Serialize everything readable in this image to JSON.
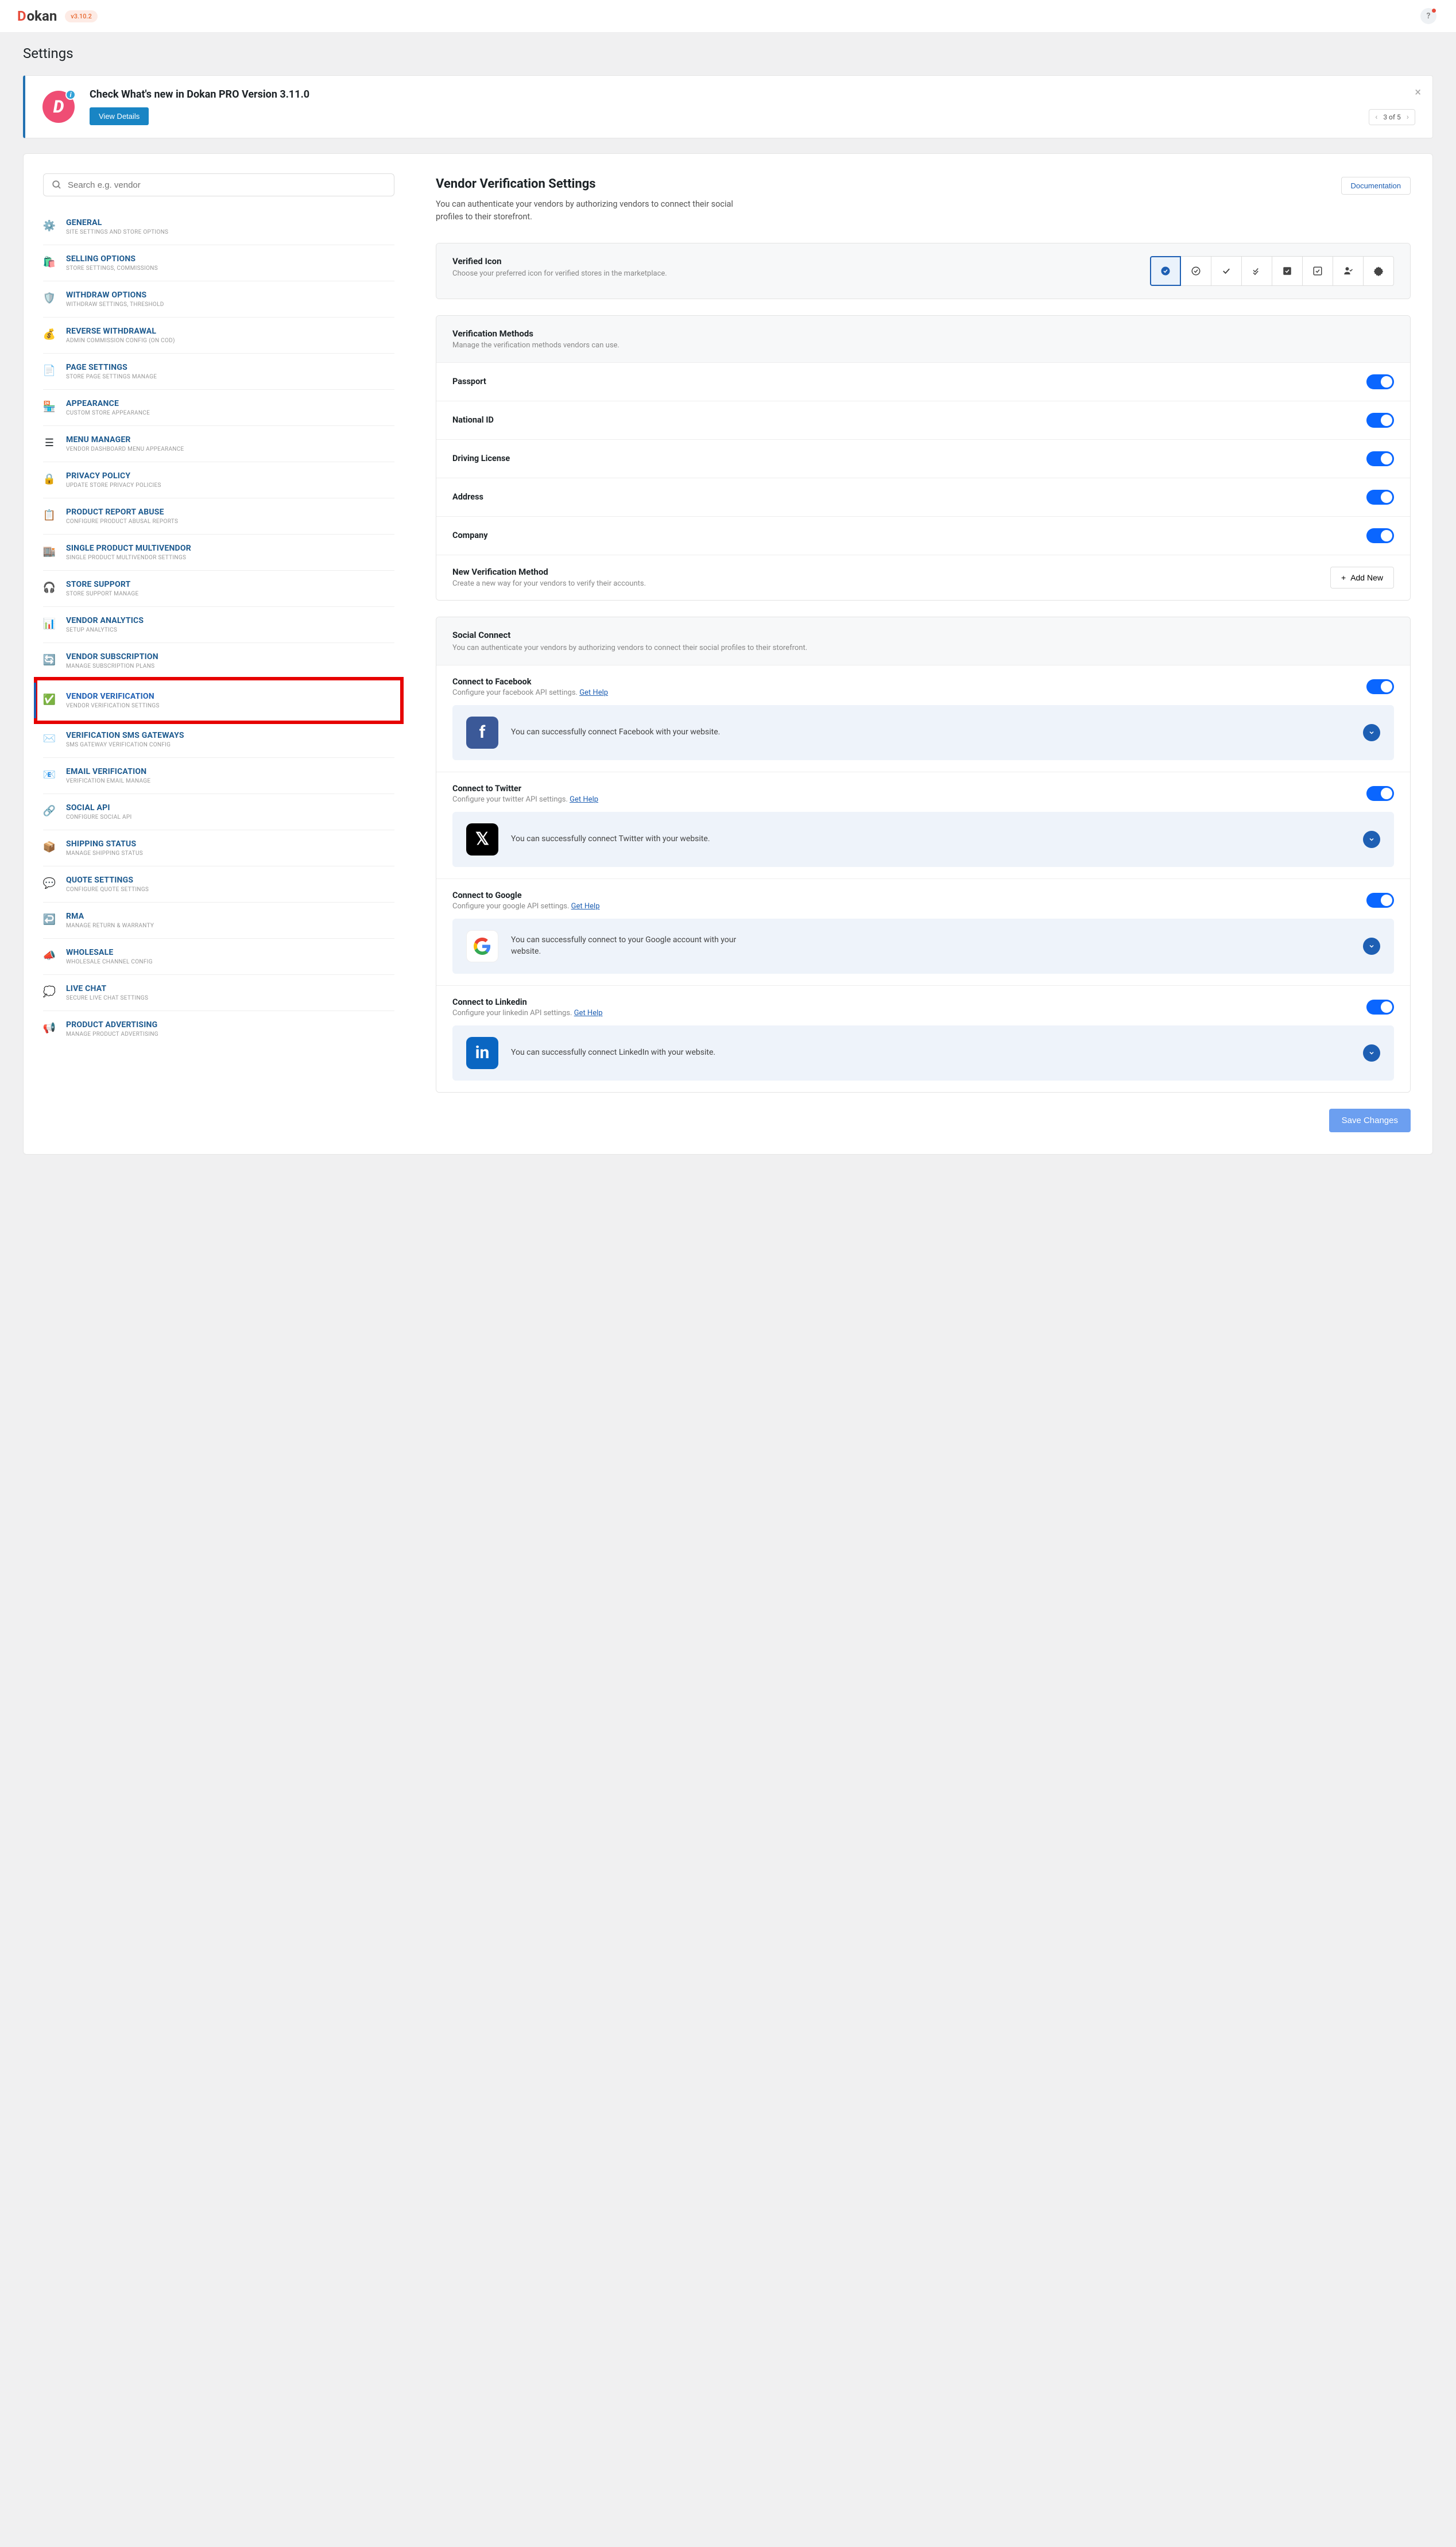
{
  "topbar": {
    "brand1": "D",
    "brand2": "okan",
    "version": "v3.10.2",
    "help": "?"
  },
  "page_title": "Settings",
  "notice": {
    "title": "Check What's new in Dokan PRO Version 3.11.0",
    "view_label": "View Details",
    "pager": "3 of 5"
  },
  "search": {
    "placeholder": "Search e.g. vendor"
  },
  "sidebar": {
    "items": [
      {
        "title": "GENERAL",
        "sub": "SITE SETTINGS AND STORE OPTIONS",
        "icon": "⚙️"
      },
      {
        "title": "SELLING OPTIONS",
        "sub": "STORE SETTINGS, COMMISSIONS",
        "icon": "🛍️"
      },
      {
        "title": "WITHDRAW OPTIONS",
        "sub": "WITHDRAW SETTINGS, THRESHOLD",
        "icon": "🛡️"
      },
      {
        "title": "REVERSE WITHDRAWAL",
        "sub": "ADMIN COMMISSION CONFIG (ON COD)",
        "icon": "💰"
      },
      {
        "title": "PAGE SETTINGS",
        "sub": "STORE PAGE SETTINGS MANAGE",
        "icon": "📄"
      },
      {
        "title": "APPEARANCE",
        "sub": "CUSTOM STORE APPEARANCE",
        "icon": "🏪"
      },
      {
        "title": "MENU MANAGER",
        "sub": "VENDOR DASHBOARD MENU APPEARANCE",
        "icon": "☰"
      },
      {
        "title": "PRIVACY POLICY",
        "sub": "UPDATE STORE PRIVACY POLICIES",
        "icon": "🔒"
      },
      {
        "title": "PRODUCT REPORT ABUSE",
        "sub": "CONFIGURE PRODUCT ABUSAL REPORTS",
        "icon": "📋"
      },
      {
        "title": "SINGLE PRODUCT MULTIVENDOR",
        "sub": "SINGLE PRODUCT MULTIVENDOR SETTINGS",
        "icon": "🏬"
      },
      {
        "title": "STORE SUPPORT",
        "sub": "STORE SUPPORT MANAGE",
        "icon": "🎧"
      },
      {
        "title": "VENDOR ANALYTICS",
        "sub": "SETUP ANALYTICS",
        "icon": "📊"
      },
      {
        "title": "VENDOR SUBSCRIPTION",
        "sub": "MANAGE SUBSCRIPTION PLANS",
        "icon": "🔄"
      },
      {
        "title": "VENDOR VERIFICATION",
        "sub": "VENDOR VERIFICATION SETTINGS",
        "icon": "✅"
      },
      {
        "title": "VERIFICATION SMS GATEWAYS",
        "sub": "SMS GATEWAY VERIFICATION CONFIG",
        "icon": "✉️"
      },
      {
        "title": "EMAIL VERIFICATION",
        "sub": "VERIFICATION EMAIL MANAGE",
        "icon": "📧"
      },
      {
        "title": "SOCIAL API",
        "sub": "CONFIGURE SOCIAL API",
        "icon": "🔗"
      },
      {
        "title": "SHIPPING STATUS",
        "sub": "MANAGE SHIPPING STATUS",
        "icon": "📦"
      },
      {
        "title": "QUOTE SETTINGS",
        "sub": "CONFIGURE QUOTE SETTINGS",
        "icon": "💬"
      },
      {
        "title": "RMA",
        "sub": "MANAGE RETURN & WARRANTY",
        "icon": "↩️"
      },
      {
        "title": "WHOLESALE",
        "sub": "WHOLESALE CHANNEL CONFIG",
        "icon": "📣"
      },
      {
        "title": "LIVE CHAT",
        "sub": "SECURE LIVE CHAT SETTINGS",
        "icon": "💭"
      },
      {
        "title": "PRODUCT ADVERTISING",
        "sub": "MANAGE PRODUCT ADVERTISING",
        "icon": "📢"
      }
    ]
  },
  "content": {
    "title": "Vendor Verification Settings",
    "doc_label": "Documentation",
    "subtitle": "You can authenticate your vendors by authorizing vendors to connect their social profiles to their storefront.",
    "verified_icon": {
      "title": "Verified Icon",
      "sub": "Choose your preferred icon for verified stores in the marketplace."
    },
    "methods_head": {
      "title": "Verification Methods",
      "sub": "Manage the verification methods vendors can use."
    },
    "methods": [
      {
        "label": "Passport"
      },
      {
        "label": "National ID"
      },
      {
        "label": "Driving License"
      },
      {
        "label": "Address"
      },
      {
        "label": "Company"
      }
    ],
    "new_method": {
      "title": "New Verification Method",
      "sub": "Create a new way for your vendors to verify their accounts.",
      "add_label": "Add New"
    },
    "social": {
      "title": "Social Connect",
      "sub": "You can authenticate your vendors by authorizing vendors to connect their social profiles to their storefront.",
      "help_label": "Get Help",
      "items": [
        {
          "title": "Connect to Facebook",
          "api": "Configure your facebook API settings.",
          "msg": "You can successfully connect Facebook with your website.",
          "icon": "f",
          "class": "fb"
        },
        {
          "title": "Connect to Twitter",
          "api": "Configure your twitter API settings.",
          "msg": "You can successfully connect Twitter with your website.",
          "icon": "𝕏",
          "class": "tw"
        },
        {
          "title": "Connect to Google",
          "api": "Configure your google API settings.",
          "msg": "You can successfully connect to your Google account with your website.",
          "icon": "G",
          "class": "gg"
        },
        {
          "title": "Connect to Linkedin",
          "api": "Configure your linkedin API settings.",
          "msg": "You can successfully connect LinkedIn with your website.",
          "icon": "in",
          "class": "li"
        }
      ]
    },
    "save_label": "Save Changes"
  }
}
